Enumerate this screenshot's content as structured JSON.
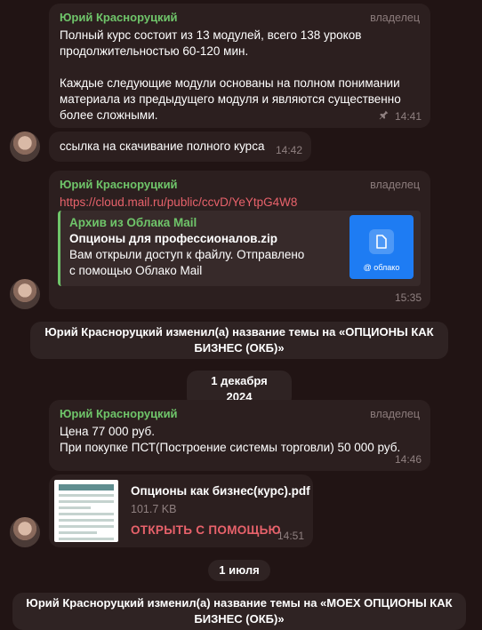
{
  "messages": {
    "m1": {
      "sender": "Юрий Красноруцкий",
      "role": "владелец",
      "text": "Полный курс состоит из 13 модулей, всего 138 уроков продолжительностью 60-120 мин.\n\nКаждые следующие модули основаны на полном понимании материала из предыдущего модуля и являются существенно более сложными.",
      "time": "14:41"
    },
    "m2": {
      "text": "ссылка на скачивание полного курса",
      "time": "14:42"
    },
    "m3": {
      "sender": "Юрий Красноруцкий",
      "role": "владелец",
      "link": "https://cloud.mail.ru/public/ccvD/YeYtpG4W8",
      "preview_title": "Архив из Облака Mail",
      "preview_name": "Опционы для профессионалов.zip",
      "preview_desc": "Вам открыли доступ к файлу. Отправлено\nс помощью Облако Mail",
      "thumb_label": "@ облако",
      "time": "15:35"
    },
    "m4": {
      "sender": "Юрий Красноруцкий",
      "role": "владелец",
      "text": "Цена 77 000 руб.\nПри покупке ПСТ(Построение системы торговли) 50 000 руб.",
      "time": "14:46"
    },
    "m5": {
      "filename": "Опционы как бизнес(курс).pdf",
      "size": "101.7 KB",
      "open_label": "ОТКРЫТЬ С ПОМОЩЬЮ",
      "time": "14:51"
    }
  },
  "service": {
    "rename1": "Юрий Красноруцкий изменил(а) название темы на «ОПЦИОНЫ КАК БИЗНЕС (ОКБ)»",
    "date1": "1 декабря 2024",
    "date2": "1 июля",
    "rename2": "Юрий Красноруцкий изменил(а) название темы на «MOEX ОПЦИОНЫ КАК БИЗНЕС (ОКБ)»"
  },
  "colors": {
    "background": "#211414",
    "bubble": "#2c1f1f",
    "sender": "#6fc56a",
    "link": "#e8626b",
    "cloud_blue": "#1e7cf3"
  },
  "icons": {
    "pin": "pin-icon",
    "doc": "document-icon"
  }
}
